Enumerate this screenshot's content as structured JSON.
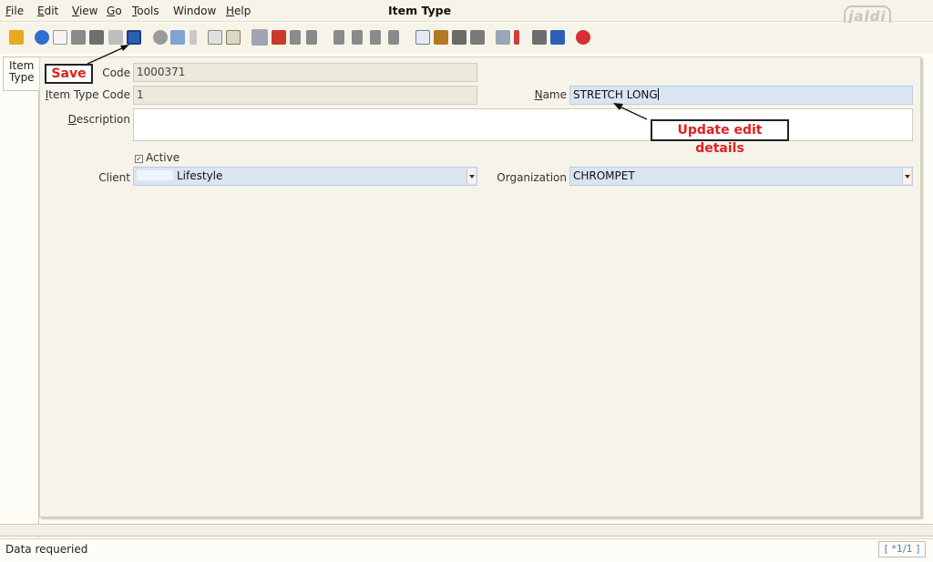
{
  "menu": {
    "items": [
      {
        "first": "F",
        "rest": "ile"
      },
      {
        "first": "E",
        "rest": "dit"
      },
      {
        "first": "V",
        "rest": "iew"
      },
      {
        "first": "G",
        "rest": "o"
      },
      {
        "first": "T",
        "rest": "ools"
      },
      {
        "first": "",
        "rest": "Window"
      },
      {
        "first": "H",
        "rest": "elp"
      }
    ],
    "window_title": "Item Type"
  },
  "logo_text": "jaldi",
  "toolbar_icons": [
    "undo-icon",
    "help-icon",
    "new-record-icon",
    "copy-icon",
    "delete-icon",
    "delete-selection-icon",
    "save-icon",
    "refresh-icon",
    "find-icon",
    "attachment-icon",
    "chat-icon",
    "history-icon",
    "parent-record-icon",
    "home-icon",
    "previous-tab-icon",
    "next-tab-icon",
    "first-record-icon",
    "previous-record-icon",
    "next-record-icon",
    "last-record-icon",
    "report-icon",
    "archive-icon",
    "print-preview-icon",
    "print-icon",
    "zoom-icon",
    "workflow-icon",
    "request-icon",
    "product-info-icon",
    "close-icon"
  ],
  "tab": {
    "label_line1": "Item",
    "label_line2": "Type"
  },
  "form": {
    "code_label": "Code",
    "code_value": "1000371",
    "item_type_code_label_first": "I",
    "item_type_code_label_rest": "tem Type Code",
    "item_type_code_value": "1",
    "name_label_first": "N",
    "name_label_rest": "ame",
    "name_value": "STRETCH LONG",
    "description_label_first": "D",
    "description_label_rest": "escription",
    "description_value": "",
    "active_label": "Active",
    "active_checked": true,
    "client_label": "Client",
    "client_value": "Lifestyle",
    "organization_label": "Organization",
    "organization_value": "CHROMPET"
  },
  "annotations": {
    "save": "Save",
    "update": "Update edit details"
  },
  "status": {
    "message": "Data requeried",
    "record_indicator": "[ *1/1 ]"
  }
}
